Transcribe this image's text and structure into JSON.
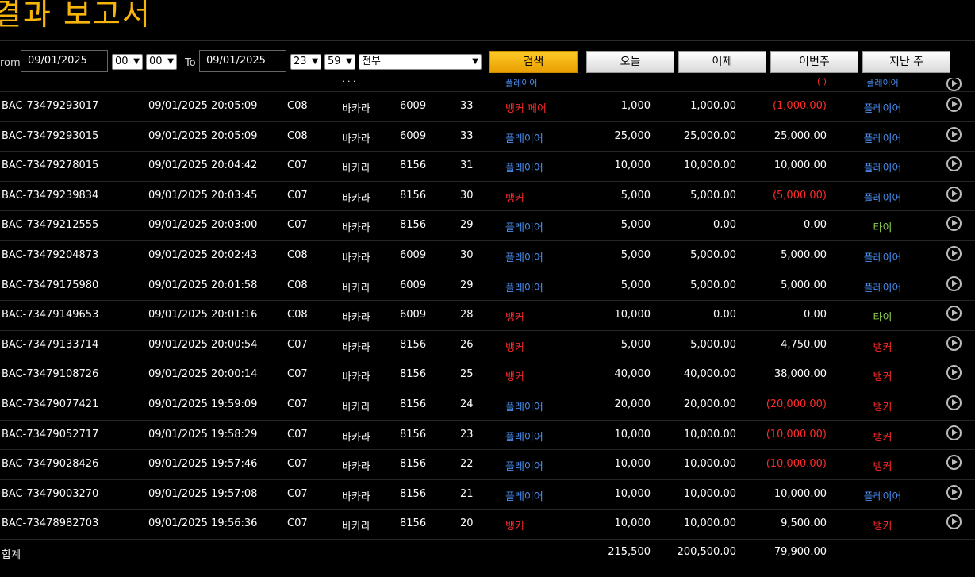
{
  "page": {
    "title": "결과 보고서"
  },
  "filter": {
    "from_label": "rom",
    "from_date": "09/01/2025",
    "from_hour": "00",
    "from_minute": "00",
    "to_label": "To",
    "to_date": "09/01/2025",
    "to_hour": "23",
    "to_minute": "59",
    "game_type": "전부",
    "search_label": "검색",
    "today_label": "오늘",
    "yesterday_label": "어제",
    "this_week_label": "이번주",
    "last_week_label": "지난 주"
  },
  "colors": {
    "accent": "#f7b409",
    "red": "#ff2a2a",
    "blue": "#4a8ff2",
    "green": "#8fd14f"
  },
  "partial_row": {
    "game": "· · ·",
    "bet": "플레이어",
    "wl": "(     )",
    "result": "플레이어"
  },
  "rows": [
    {
      "id": "BAC-73479293017",
      "date": "09/01/2025 20:05:09",
      "table": "C08",
      "game": "바카라",
      "shoe": "6009",
      "round": "33",
      "bet": "뱅커 페어",
      "bet_color": "red",
      "amount": "1,000",
      "valid": "1,000.00",
      "winloss": "(1,000.00)",
      "wl_color": "red",
      "result": "플레이어",
      "result_color": "blue"
    },
    {
      "id": "BAC-73479293015",
      "date": "09/01/2025 20:05:09",
      "table": "C08",
      "game": "바카라",
      "shoe": "6009",
      "round": "33",
      "bet": "플레이어",
      "bet_color": "blue",
      "amount": "25,000",
      "valid": "25,000.00",
      "winloss": "25,000.00",
      "wl_color": "white",
      "result": "플레이어",
      "result_color": "blue"
    },
    {
      "id": "BAC-73479278015",
      "date": "09/01/2025 20:04:42",
      "table": "C07",
      "game": "바카라",
      "shoe": "8156",
      "round": "31",
      "bet": "플레이어",
      "bet_color": "blue",
      "amount": "10,000",
      "valid": "10,000.00",
      "winloss": "10,000.00",
      "wl_color": "white",
      "result": "플레이어",
      "result_color": "blue"
    },
    {
      "id": "BAC-73479239834",
      "date": "09/01/2025 20:03:45",
      "table": "C07",
      "game": "바카라",
      "shoe": "8156",
      "round": "30",
      "bet": "뱅커",
      "bet_color": "red",
      "amount": "5,000",
      "valid": "5,000.00",
      "winloss": "(5,000.00)",
      "wl_color": "red",
      "result": "플레이어",
      "result_color": "blue"
    },
    {
      "id": "BAC-73479212555",
      "date": "09/01/2025 20:03:00",
      "table": "C07",
      "game": "바카라",
      "shoe": "8156",
      "round": "29",
      "bet": "플레이어",
      "bet_color": "blue",
      "amount": "5,000",
      "valid": "0.00",
      "winloss": "0.00",
      "wl_color": "white",
      "result": "타이",
      "result_color": "green"
    },
    {
      "id": "BAC-73479204873",
      "date": "09/01/2025 20:02:43",
      "table": "C08",
      "game": "바카라",
      "shoe": "6009",
      "round": "30",
      "bet": "플레이어",
      "bet_color": "blue",
      "amount": "5,000",
      "valid": "5,000.00",
      "winloss": "5,000.00",
      "wl_color": "white",
      "result": "플레이어",
      "result_color": "blue"
    },
    {
      "id": "BAC-73479175980",
      "date": "09/01/2025 20:01:58",
      "table": "C08",
      "game": "바카라",
      "shoe": "6009",
      "round": "29",
      "bet": "플레이어",
      "bet_color": "blue",
      "amount": "5,000",
      "valid": "5,000.00",
      "winloss": "5,000.00",
      "wl_color": "white",
      "result": "플레이어",
      "result_color": "blue"
    },
    {
      "id": "BAC-73479149653",
      "date": "09/01/2025 20:01:16",
      "table": "C08",
      "game": "바카라",
      "shoe": "6009",
      "round": "28",
      "bet": "뱅커",
      "bet_color": "red",
      "amount": "10,000",
      "valid": "0.00",
      "winloss": "0.00",
      "wl_color": "white",
      "result": "타이",
      "result_color": "green"
    },
    {
      "id": "BAC-73479133714",
      "date": "09/01/2025 20:00:54",
      "table": "C07",
      "game": "바카라",
      "shoe": "8156",
      "round": "26",
      "bet": "뱅커",
      "bet_color": "red",
      "amount": "5,000",
      "valid": "5,000.00",
      "winloss": "4,750.00",
      "wl_color": "white",
      "result": "뱅커",
      "result_color": "red"
    },
    {
      "id": "BAC-73479108726",
      "date": "09/01/2025 20:00:14",
      "table": "C07",
      "game": "바카라",
      "shoe": "8156",
      "round": "25",
      "bet": "뱅커",
      "bet_color": "red",
      "amount": "40,000",
      "valid": "40,000.00",
      "winloss": "38,000.00",
      "wl_color": "white",
      "result": "뱅커",
      "result_color": "red"
    },
    {
      "id": "BAC-73479077421",
      "date": "09/01/2025 19:59:09",
      "table": "C07",
      "game": "바카라",
      "shoe": "8156",
      "round": "24",
      "bet": "플레이어",
      "bet_color": "blue",
      "amount": "20,000",
      "valid": "20,000.00",
      "winloss": "(20,000.00)",
      "wl_color": "red",
      "result": "뱅커",
      "result_color": "red"
    },
    {
      "id": "BAC-73479052717",
      "date": "09/01/2025 19:58:29",
      "table": "C07",
      "game": "바카라",
      "shoe": "8156",
      "round": "23",
      "bet": "플레이어",
      "bet_color": "blue",
      "amount": "10,000",
      "valid": "10,000.00",
      "winloss": "(10,000.00)",
      "wl_color": "red",
      "result": "뱅커",
      "result_color": "red"
    },
    {
      "id": "BAC-73479028426",
      "date": "09/01/2025 19:57:46",
      "table": "C07",
      "game": "바카라",
      "shoe": "8156",
      "round": "22",
      "bet": "플레이어",
      "bet_color": "blue",
      "amount": "10,000",
      "valid": "10,000.00",
      "winloss": "(10,000.00)",
      "wl_color": "red",
      "result": "뱅커",
      "result_color": "red"
    },
    {
      "id": "BAC-73479003270",
      "date": "09/01/2025 19:57:08",
      "table": "C07",
      "game": "바카라",
      "shoe": "8156",
      "round": "21",
      "bet": "플레이어",
      "bet_color": "blue",
      "amount": "10,000",
      "valid": "10,000.00",
      "winloss": "10,000.00",
      "wl_color": "white",
      "result": "플레이어",
      "result_color": "blue"
    },
    {
      "id": "BAC-73478982703",
      "date": "09/01/2025 19:56:36",
      "table": "C07",
      "game": "바카라",
      "shoe": "8156",
      "round": "20",
      "bet": "뱅커",
      "bet_color": "red",
      "amount": "10,000",
      "valid": "10,000.00",
      "winloss": "9,500.00",
      "wl_color": "white",
      "result": "뱅커",
      "result_color": "red"
    }
  ],
  "totals": {
    "label": "합계",
    "amount": "215,500",
    "valid": "200,500.00",
    "winloss": "79,900.00"
  }
}
